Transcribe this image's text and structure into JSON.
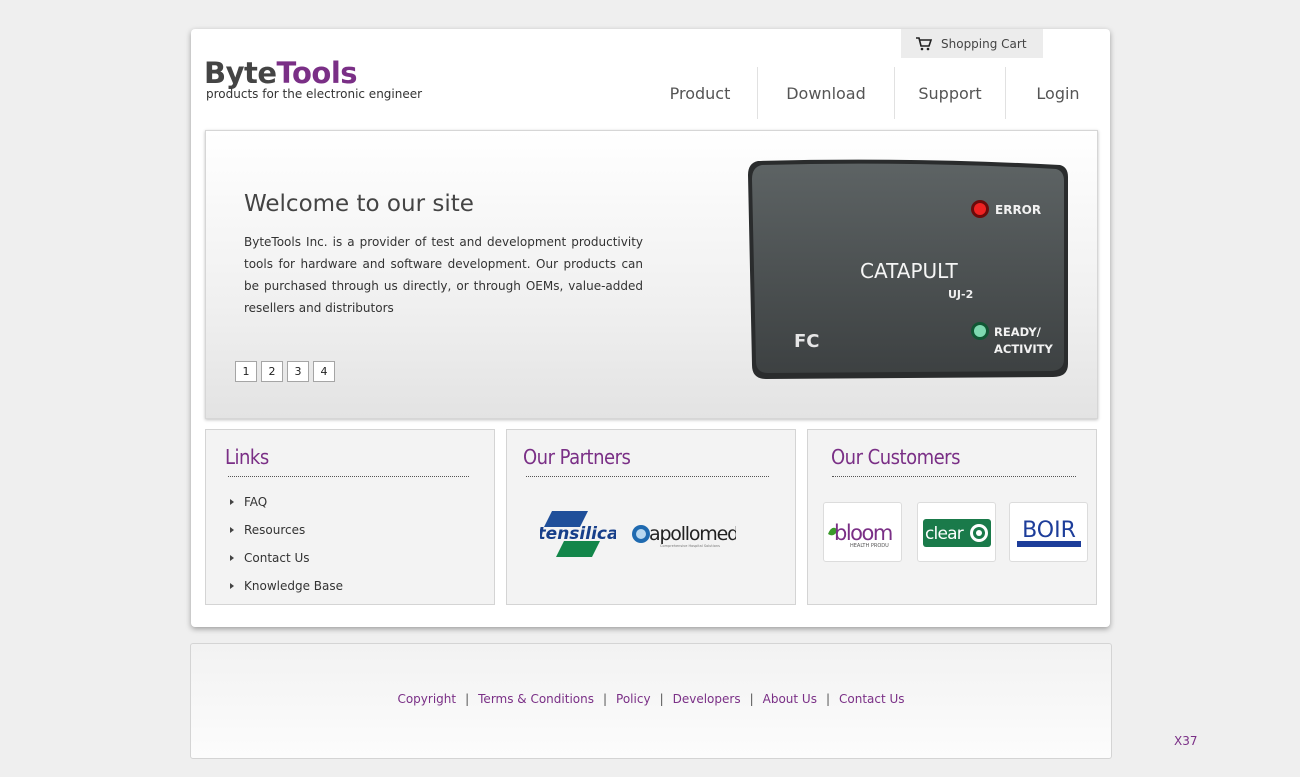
{
  "cart": {
    "label": "Shopping Cart",
    "icon": "cart-icon"
  },
  "logo": {
    "part1": "Byte",
    "part2": "Tools",
    "tagline": "products for the electronic engineer"
  },
  "nav": [
    "Product",
    "Download",
    "Support",
    "Login"
  ],
  "hero": {
    "title": "Welcome to our site",
    "body": "ByteTools Inc. is a provider of test and development productivity tools for hardware and software development. Our products can be purchased through us directly, or through OEMs, value-added resellers and distributors",
    "pages": [
      "1",
      "2",
      "3",
      "4"
    ],
    "device": {
      "brand": "CATAPULT",
      "model": "UJ-2",
      "led_error": "ERROR",
      "led_ready_1": "READY/",
      "led_ready_2": "ACTIVITY",
      "mark": "FC"
    }
  },
  "links": {
    "title": "Links",
    "items": [
      "FAQ",
      "Resources",
      "Contact Us",
      "Knowledge Base"
    ]
  },
  "partners": {
    "title": "Our Partners",
    "logos": [
      "tensilica",
      "apollomed"
    ],
    "apollo_sub": "Comprehensive Hospital Solutions"
  },
  "customers": {
    "title": "Our Customers",
    "logos": [
      "bloom",
      "clear",
      "BOIR"
    ],
    "bloom_sub": "HEALTH PRODU"
  },
  "footer": {
    "links": [
      "Copyright",
      "Terms & Conditions",
      "Policy",
      "Developers",
      "About Us",
      "Contact Us"
    ],
    "separator": "|"
  },
  "badge": "X37",
  "colors": {
    "accent": "#7a2f86",
    "background": "#efefef"
  }
}
